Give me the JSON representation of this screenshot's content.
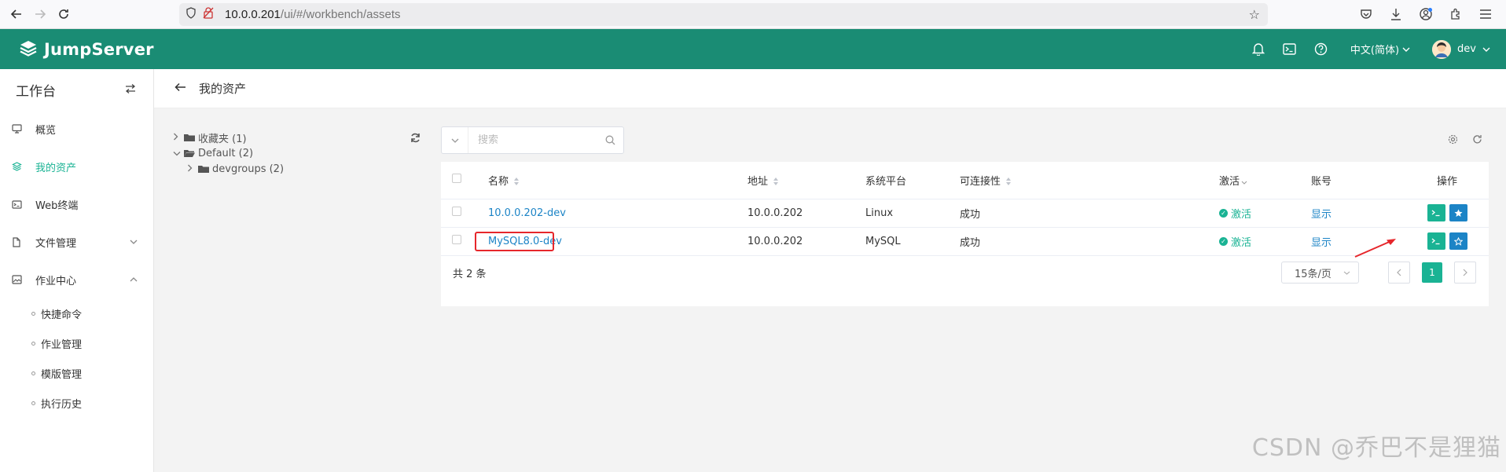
{
  "browser": {
    "url_host": "10.0.0.201",
    "url_path": "/ui/#/workbench/assets"
  },
  "header": {
    "brand": "JumpServer",
    "language": "中文(简体)",
    "user": "dev"
  },
  "sidebar": {
    "title": "工作台",
    "items": [
      {
        "label": "概览"
      },
      {
        "label": "我的资产"
      },
      {
        "label": "Web终端"
      },
      {
        "label": "文件管理"
      },
      {
        "label": "作业中心"
      }
    ],
    "sub_items": [
      {
        "label": "快捷命令"
      },
      {
        "label": "作业管理"
      },
      {
        "label": "模版管理"
      },
      {
        "label": "执行历史"
      }
    ]
  },
  "page": {
    "title": "我的资产"
  },
  "tree": [
    {
      "label": "收藏夹 (1)"
    },
    {
      "label": "Default (2)"
    },
    {
      "label": "devgroups (2)"
    }
  ],
  "search": {
    "placeholder": "搜索"
  },
  "table": {
    "columns": [
      "名称",
      "地址",
      "系统平台",
      "可连接性",
      "激活",
      "账号",
      "操作"
    ],
    "rows": [
      {
        "name": "10.0.0.202-dev",
        "address": "10.0.0.202",
        "platform": "Linux",
        "connectivity": "成功",
        "active": "激活",
        "account": "显示"
      },
      {
        "name": "MySQL8.0-dev",
        "address": "10.0.0.202",
        "platform": "MySQL",
        "connectivity": "成功",
        "active": "激活",
        "account": "显示"
      }
    ]
  },
  "pagination": {
    "total": "共 2 条",
    "page_size": "15条/页",
    "current": "1"
  },
  "watermark": "CSDN @乔巴不是狸猫",
  "colors": {
    "brand": "#1a8c74",
    "accent": "#1ab394",
    "link": "#1c84c6",
    "highlight": "#e6262b"
  }
}
